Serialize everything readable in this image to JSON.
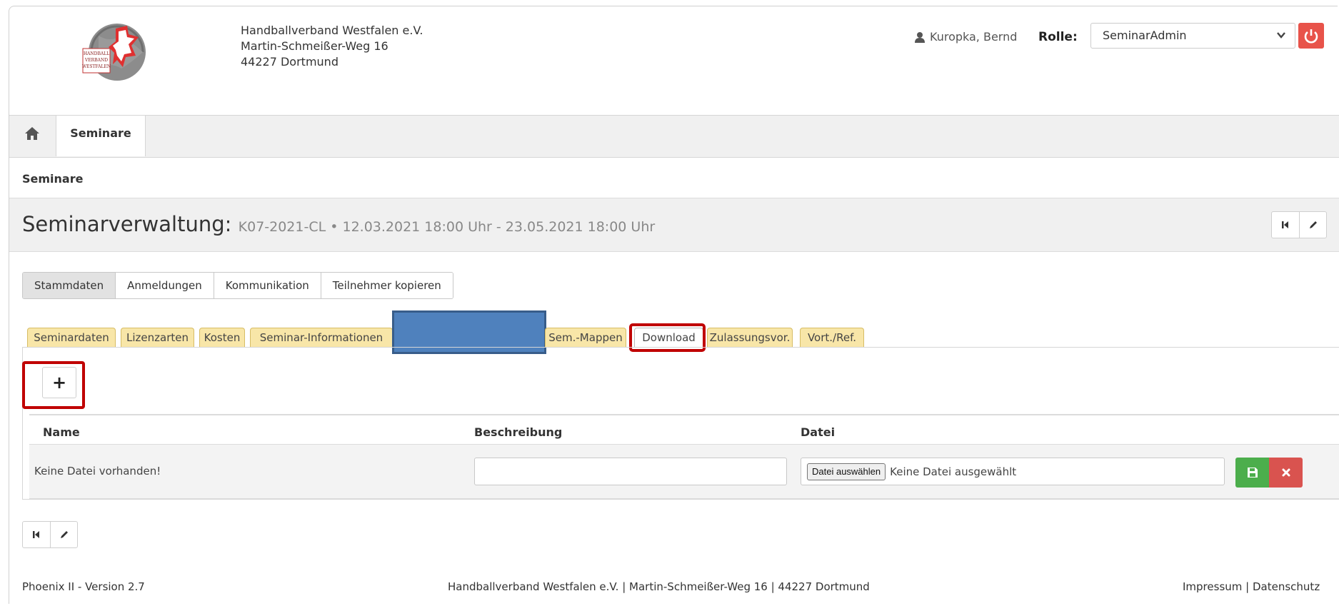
{
  "header": {
    "org_lines": [
      "Handballverband Westfalen e.V.",
      "Martin-Schmeißer-Weg 16",
      "44227 Dortmund"
    ],
    "logo_text": [
      "HANDBALL",
      "VERBAND",
      "WESTFALEN"
    ],
    "user_name": "Kuropka, Bernd",
    "role_label": "Rolle:",
    "role_value": "SeminarAdmin"
  },
  "nav": {
    "home_icon": "home-icon",
    "tab_label": "Seminare"
  },
  "breadcrumb": "Seminare",
  "title": {
    "main": "Seminarverwaltung:",
    "sub": "K07-2021-CL • 12.03.2021 18:00 Uhr - 23.05.2021 18:00 Uhr"
  },
  "main_tabs": [
    "Stammdaten",
    "Anmeldungen",
    "Kommunikation",
    "Teilnehmer kopieren"
  ],
  "sub_tabs": [
    "Seminardaten",
    "Lizenzarten",
    "Kosten",
    "Seminar-Informationen",
    "Sem.-Mappen",
    "Download",
    "Zulassungsvor.",
    "Vort./Ref."
  ],
  "table": {
    "headers": [
      "Name",
      "Beschreibung",
      "Datei"
    ],
    "row": {
      "name": "Keine Datei vorhanden!",
      "description": "",
      "file_button": "Datei auswählen",
      "file_status": "Keine Datei ausgewählt"
    }
  },
  "add_button": "+",
  "footer": {
    "left": "Phoenix II - Version 2.7",
    "middle": "Handballverband Westfalen e.V. | Martin-Schmeißer-Weg 16 | 44227 Dortmund",
    "impressum": "Impressum",
    "separator": "|",
    "datenschutz": "Datenschutz"
  },
  "colors": {
    "tab_yellow": "#f8e6a8",
    "highlight_red": "#c00000",
    "redaction_blue": "#4f81bd",
    "save_green": "#4cae4c",
    "delete_red": "#d9534f"
  }
}
